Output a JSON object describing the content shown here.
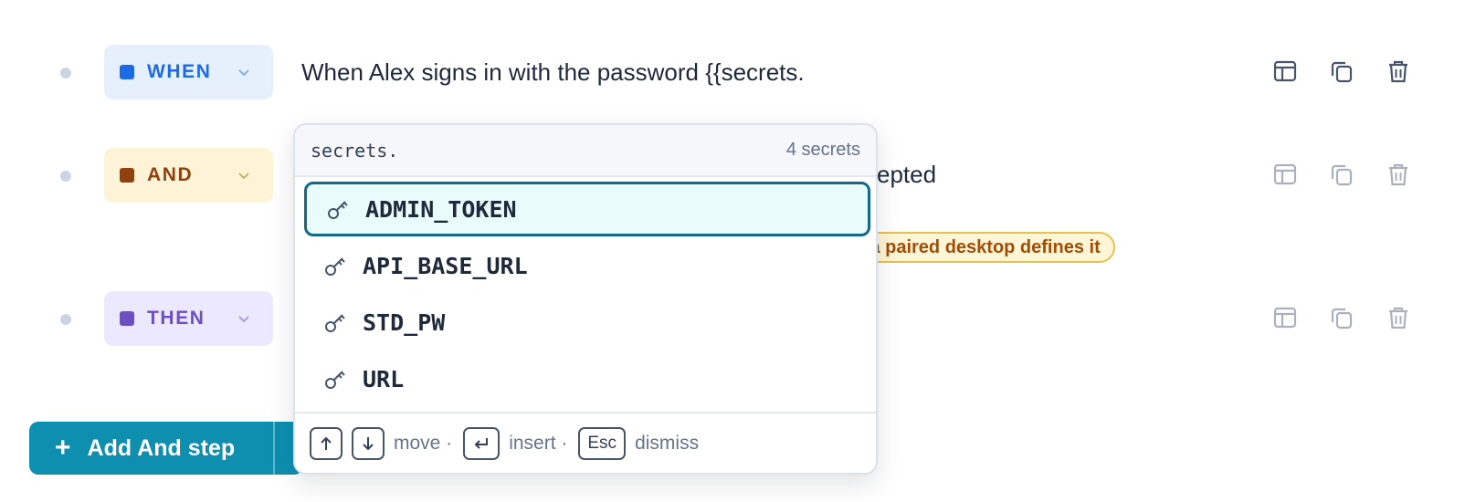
{
  "steps": [
    {
      "keyword": "WHEN",
      "text": "When Alex signs in with the password {{secrets."
    },
    {
      "keyword": "AND",
      "text_visible_tail": "epted"
    },
    {
      "keyword": "THEN"
    }
  ],
  "warning": "only if a paired desktop defines it",
  "add_button": {
    "label": "Add And step"
  },
  "autocomplete": {
    "query": "secrets.",
    "count": "4 secrets",
    "options": [
      "ADMIN_TOKEN",
      "API_BASE_URL",
      "STD_PW",
      "URL"
    ],
    "selected_index": 0,
    "footer": {
      "move": "move ·",
      "insert": "insert ·",
      "esc": "Esc",
      "dismiss": "dismiss"
    }
  },
  "colors": {
    "when": "#1d6ae5",
    "and": "#92400e",
    "then": "#6d4fc4",
    "accent": "#0e8fb0",
    "selected_border": "#13698a"
  },
  "icons": {
    "row_actions": [
      "layout-icon",
      "copy-icon",
      "trash-icon"
    ],
    "option": "key-icon",
    "footer": [
      "arrow-up-icon",
      "arrow-down-icon",
      "enter-icon"
    ]
  }
}
